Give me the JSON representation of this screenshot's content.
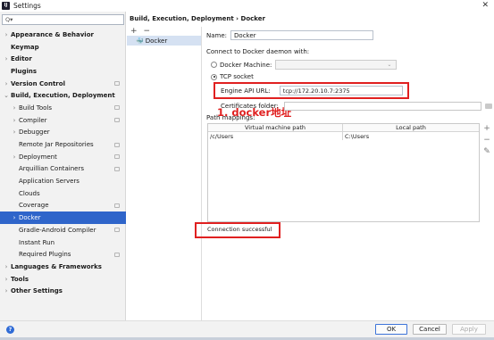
{
  "window": {
    "title": "Settings",
    "app_icon_text": "IJ",
    "close_glyph": "✕"
  },
  "sidebar": {
    "search_placeholder": "Q▾",
    "items": [
      {
        "label": "Appearance & Behavior",
        "arrow": "›",
        "bold": true,
        "indent": 0,
        "proj": false
      },
      {
        "label": "Keymap",
        "arrow": "",
        "bold": true,
        "indent": 0,
        "proj": false
      },
      {
        "label": "Editor",
        "arrow": "›",
        "bold": true,
        "indent": 0,
        "proj": false
      },
      {
        "label": "Plugins",
        "arrow": "",
        "bold": true,
        "indent": 0,
        "proj": false
      },
      {
        "label": "Version Control",
        "arrow": "›",
        "bold": true,
        "indent": 0,
        "proj": true
      },
      {
        "label": "Build, Execution, Deployment",
        "arrow": "⌄",
        "bold": true,
        "indent": 0,
        "proj": false
      },
      {
        "label": "Build Tools",
        "arrow": "›",
        "bold": false,
        "indent": 1,
        "proj": true
      },
      {
        "label": "Compiler",
        "arrow": "›",
        "bold": false,
        "indent": 1,
        "proj": true
      },
      {
        "label": "Debugger",
        "arrow": "›",
        "bold": false,
        "indent": 1,
        "proj": false
      },
      {
        "label": "Remote Jar Repositories",
        "arrow": "",
        "bold": false,
        "indent": 1,
        "proj": true
      },
      {
        "label": "Deployment",
        "arrow": "›",
        "bold": false,
        "indent": 1,
        "proj": true
      },
      {
        "label": "Arquillian Containers",
        "arrow": "",
        "bold": false,
        "indent": 1,
        "proj": true
      },
      {
        "label": "Application Servers",
        "arrow": "",
        "bold": false,
        "indent": 1,
        "proj": false
      },
      {
        "label": "Clouds",
        "arrow": "",
        "bold": false,
        "indent": 1,
        "proj": false
      },
      {
        "label": "Coverage",
        "arrow": "",
        "bold": false,
        "indent": 1,
        "proj": true
      },
      {
        "label": "Docker",
        "arrow": "›",
        "bold": false,
        "indent": 1,
        "proj": false,
        "selected": true
      },
      {
        "label": "Gradle-Android Compiler",
        "arrow": "",
        "bold": false,
        "indent": 1,
        "proj": true
      },
      {
        "label": "Instant Run",
        "arrow": "",
        "bold": false,
        "indent": 1,
        "proj": false
      },
      {
        "label": "Required Plugins",
        "arrow": "",
        "bold": false,
        "indent": 1,
        "proj": true
      },
      {
        "label": "Languages & Frameworks",
        "arrow": "›",
        "bold": true,
        "indent": 0,
        "proj": false
      },
      {
        "label": "Tools",
        "arrow": "›",
        "bold": true,
        "indent": 0,
        "proj": false
      },
      {
        "label": "Other Settings",
        "arrow": "›",
        "bold": true,
        "indent": 0,
        "proj": false
      }
    ]
  },
  "main": {
    "breadcrumb": "Build, Execution, Deployment  ›  Docker",
    "list": {
      "add": "+",
      "remove": "−",
      "item_icon": "🐳",
      "item_label": "Docker"
    },
    "form": {
      "name_label": "Name:",
      "name_value": "Docker",
      "connect_label": "Connect to Docker daemon with:",
      "docker_machine_label": "Docker Machine:",
      "docker_machine_chevron": "⌄",
      "tcp_label": "TCP socket",
      "engine_api_label": "Engine API URL:",
      "engine_api_value": "tcp://172.20.10.7:2375",
      "cert_label": "Certificates folder:",
      "path_mappings_label": "Path mappings:",
      "annotation": "1. docker地址",
      "table": {
        "headers": [
          "Virtual machine path",
          "Local path"
        ],
        "rows": [
          [
            "/c/Users",
            "C:\\Users"
          ]
        ]
      },
      "side_tools": [
        "+",
        "−",
        "✎"
      ],
      "status": "Connection successful"
    }
  },
  "footer": {
    "help": "?",
    "ok": "OK",
    "cancel": "Cancel",
    "apply": "Apply"
  }
}
